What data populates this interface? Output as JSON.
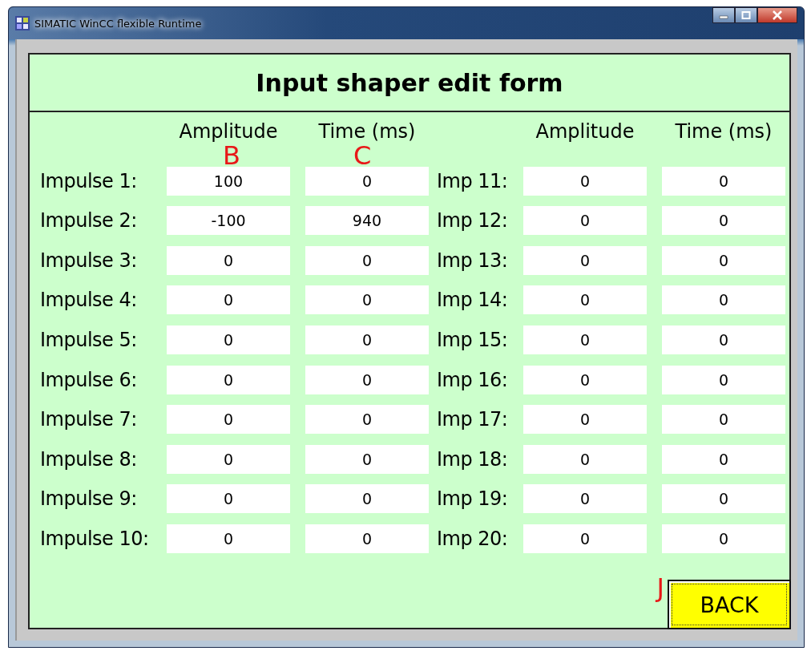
{
  "window": {
    "title": "SIMATIC WinCC flexible Runtime"
  },
  "form": {
    "title": "Input shaper edit form",
    "column_headers": [
      "Amplitude",
      "Time (ms)",
      "Amplitude",
      "Time (ms)"
    ],
    "annotations": [
      "B",
      "C",
      "J"
    ],
    "rows": [
      {
        "left": {
          "label": "Impulse 1:",
          "amplitude": "100",
          "time": "0"
        },
        "right": {
          "label": "Imp 11:",
          "amplitude": "0",
          "time": "0"
        }
      },
      {
        "left": {
          "label": "Impulse 2:",
          "amplitude": "-100",
          "time": "940"
        },
        "right": {
          "label": "Imp 12:",
          "amplitude": "0",
          "time": "0"
        }
      },
      {
        "left": {
          "label": "Impulse 3:",
          "amplitude": "0",
          "time": "0"
        },
        "right": {
          "label": "Imp 13:",
          "amplitude": "0",
          "time": "0"
        }
      },
      {
        "left": {
          "label": "Impulse 4:",
          "amplitude": "0",
          "time": "0"
        },
        "right": {
          "label": "Imp 14:",
          "amplitude": "0",
          "time": "0"
        }
      },
      {
        "left": {
          "label": "Impulse 5:",
          "amplitude": "0",
          "time": "0"
        },
        "right": {
          "label": "Imp 15:",
          "amplitude": "0",
          "time": "0"
        }
      },
      {
        "left": {
          "label": "Impulse 6:",
          "amplitude": "0",
          "time": "0"
        },
        "right": {
          "label": "Imp 16:",
          "amplitude": "0",
          "time": "0"
        }
      },
      {
        "left": {
          "label": "Impulse 7:",
          "amplitude": "0",
          "time": "0"
        },
        "right": {
          "label": "Imp 17:",
          "amplitude": "0",
          "time": "0"
        }
      },
      {
        "left": {
          "label": "Impulse 8:",
          "amplitude": "0",
          "time": "0"
        },
        "right": {
          "label": "Imp 18:",
          "amplitude": "0",
          "time": "0"
        }
      },
      {
        "left": {
          "label": "Impulse 9:",
          "amplitude": "0",
          "time": "0"
        },
        "right": {
          "label": "Imp 19:",
          "amplitude": "0",
          "time": "0"
        }
      },
      {
        "left": {
          "label": "Impulse 10:",
          "amplitude": "0",
          "time": "0"
        },
        "right": {
          "label": "Imp 20:",
          "amplitude": "0",
          "time": "0"
        }
      }
    ],
    "back_button": "BACK"
  }
}
